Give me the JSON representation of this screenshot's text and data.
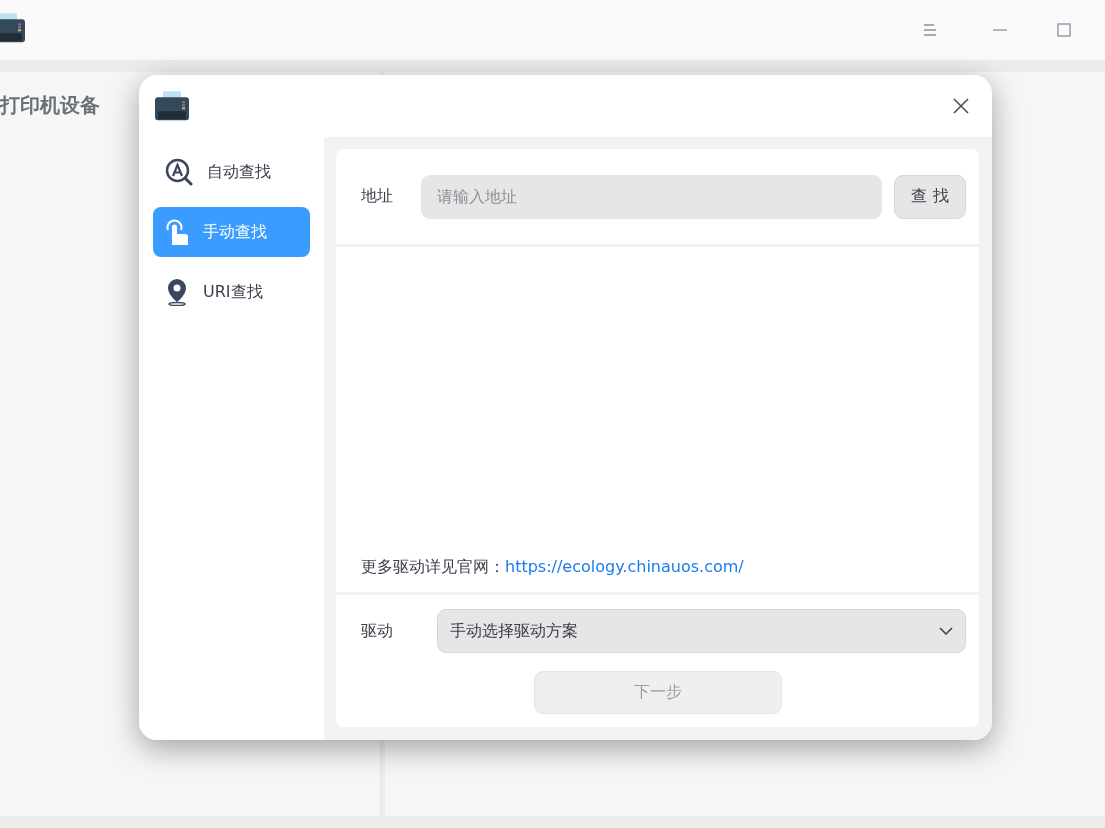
{
  "app_window": {
    "section_title": "打印机设备"
  },
  "dialog": {
    "nav": [
      {
        "kind": "auto",
        "label": "自动查找",
        "selected": false
      },
      {
        "kind": "manual",
        "label": "手动查找",
        "selected": true
      },
      {
        "kind": "uri",
        "label": "URI查找",
        "selected": false
      }
    ],
    "address": {
      "label": "地址",
      "placeholder": "请输入地址",
      "button": "查 找"
    },
    "hint": {
      "text": "更多驱动详见官网：",
      "link": "https://ecology.chinauos.com/"
    },
    "driver": {
      "label": "驱动",
      "value": "手动选择驱动方案"
    },
    "next_button": {
      "label": "下一步",
      "disabled": true
    }
  }
}
